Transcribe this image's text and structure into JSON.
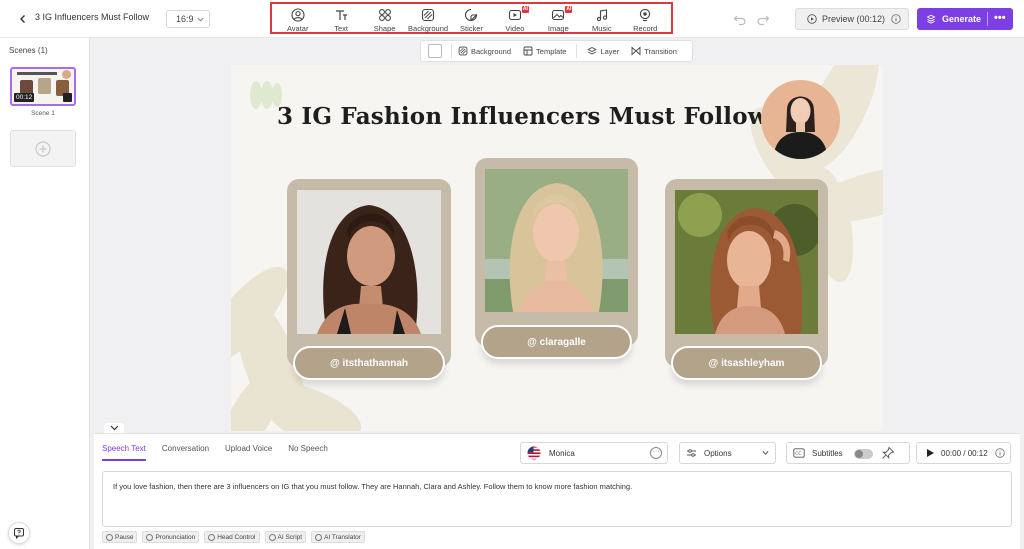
{
  "header": {
    "project_title": "3 IG Influencers Must Follow",
    "aspect_ratio": "16:9",
    "tools": [
      {
        "label": "Avatar",
        "icon": "avatar-icon",
        "ai": false
      },
      {
        "label": "Text",
        "icon": "text-icon",
        "ai": false
      },
      {
        "label": "Shape",
        "icon": "shape-icon",
        "ai": false
      },
      {
        "label": "Background",
        "icon": "background-icon",
        "ai": false
      },
      {
        "label": "Sticker",
        "icon": "sticker-icon",
        "ai": false
      },
      {
        "label": "Video",
        "icon": "video-icon",
        "ai": true
      },
      {
        "label": "Image",
        "icon": "image-icon",
        "ai": true
      },
      {
        "label": "Music",
        "icon": "music-icon",
        "ai": false
      },
      {
        "label": "Record",
        "icon": "record-icon",
        "ai": false
      }
    ],
    "ai_badge": "AI",
    "preview_label": "Preview (00:12)",
    "generate_label": "Generate",
    "accent_color": "#7b3fe4",
    "highlight_color": "#e2383d"
  },
  "scenes": {
    "title": "Scenes (1)",
    "items": [
      {
        "label": "Scene 1",
        "duration": "00:12"
      }
    ]
  },
  "canvas_toolbar": {
    "background": "Background",
    "template": "Template",
    "layer": "Layer",
    "transition": "Transition"
  },
  "slide": {
    "title": "3 IG Fashion Influencers Must Follow",
    "handles": [
      "@ itsthathannah",
      "@ claragalle",
      "@ itsashleyham"
    ],
    "card_color": "#c6bba8",
    "pill_color": "#b2a38a"
  },
  "script_panel": {
    "tabs": [
      "Speech Text",
      "Conversation",
      "Upload Voice",
      "No Speech"
    ],
    "active_tab": "Speech Text",
    "voice": "Monica",
    "options_label": "Options",
    "subtitles_label": "Subtitles",
    "subtitles_on": false,
    "time_display": "00:00 / 00:12",
    "script_text": "If you love fashion, then there are 3 influencers on IG that you must follow. They are Hannah, Clara and Ashley. Follow them to know more fashion matching.",
    "chips": [
      "Pause",
      "Pronunciation",
      "Head Control",
      "AI Script",
      "AI Translator"
    ]
  }
}
